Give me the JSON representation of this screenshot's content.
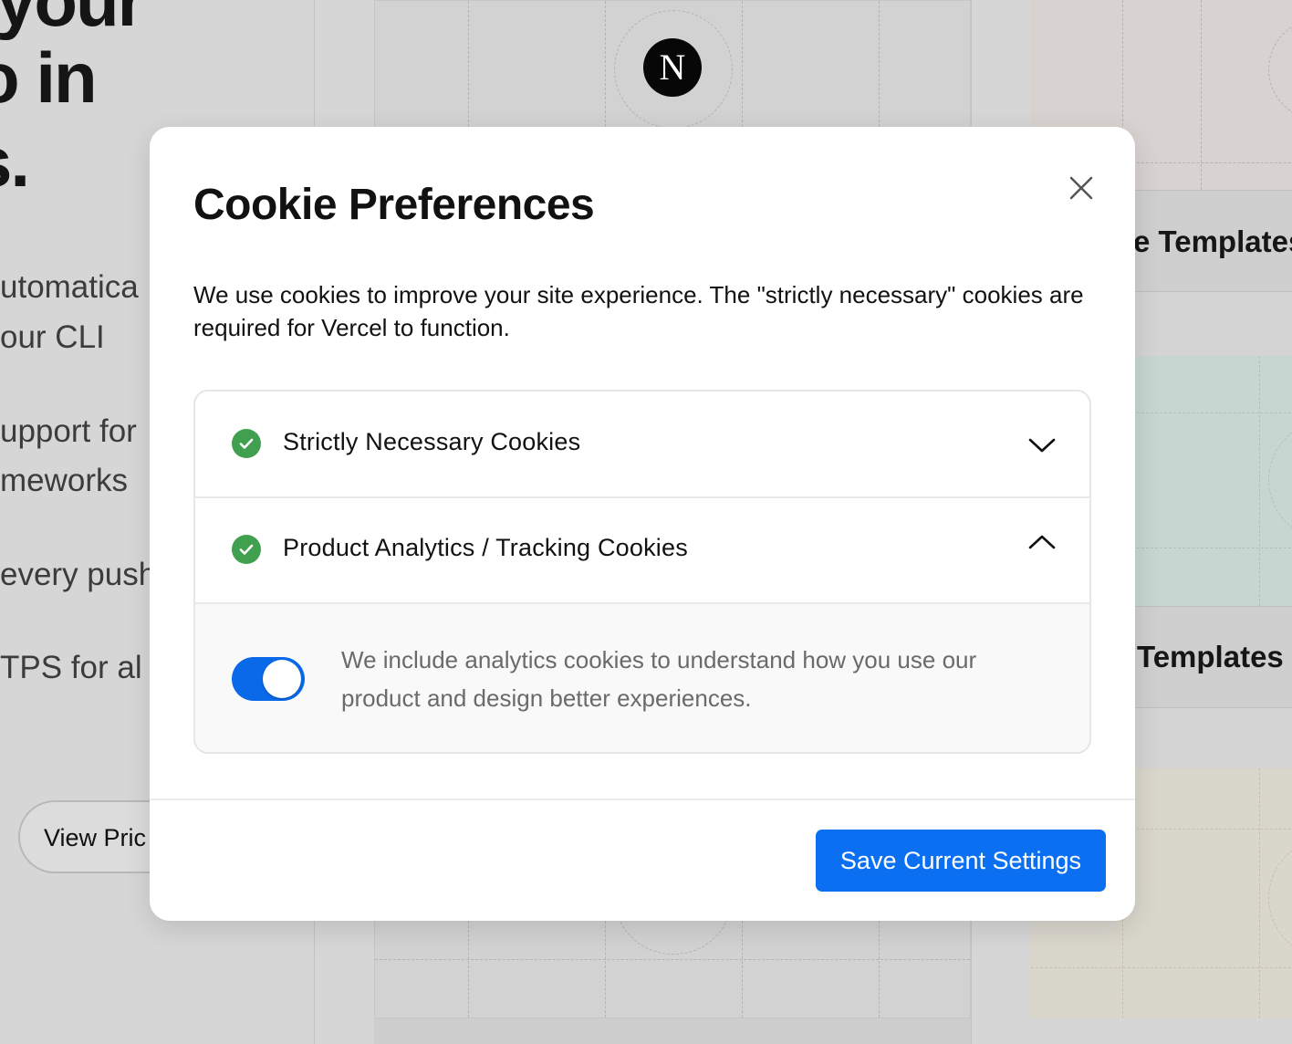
{
  "background": {
    "hero_title_lines": [
      "your",
      "in",
      "s."
    ],
    "hero_title_visible_prefix": [
      "",
      "",
      ""
    ],
    "feature_lines": [
      {
        "text": "utomatica"
      },
      {
        "text": "our CLI"
      },
      {
        "text": "upport for"
      },
      {
        "text": "meworks"
      },
      {
        "text": "every push"
      },
      {
        "text": "TPS for al"
      }
    ],
    "view_pricing_label": "View Pric",
    "template_cards": [
      "e Templates",
      "Templates"
    ],
    "logo_letter": "N"
  },
  "modal": {
    "title": "Cookie Preferences",
    "close_label": "×",
    "description": "We use cookies to improve your site experience. The \"strictly necessary\" cookies are required for Vercel to function.",
    "sections": [
      {
        "label": "Strictly Necessary Cookies",
        "expanded": false,
        "status": "enabled"
      },
      {
        "label": "Product Analytics / Tracking Cookies",
        "expanded": true,
        "status": "enabled",
        "toggle_on": true,
        "details": "We include analytics cookies to understand how you use our product and design better experiences."
      }
    ],
    "save_button": "Save Current Settings"
  },
  "colors": {
    "accent_blue": "#0a6ff0",
    "check_green": "#40a050",
    "toggle_blue": "#0969e8"
  }
}
